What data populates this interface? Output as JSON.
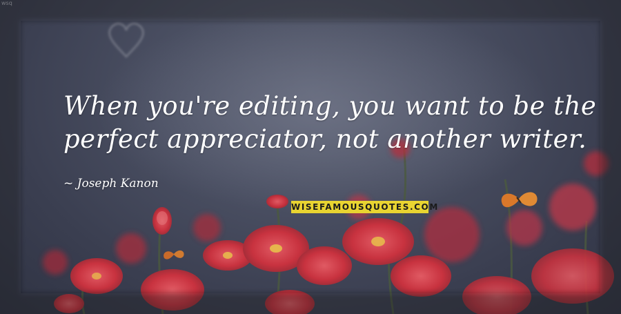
{
  "quote": {
    "line1": "When you're editing, you want to be the",
    "line2": "perfect appreciator, not another writer."
  },
  "author": "~ Joseph Kanon",
  "watermark": "WISEFAMOUSQUOTES.COM",
  "corner_mark": "wsq",
  "colors": {
    "background": "#434859",
    "flower": "#c8323f",
    "watermark_bg": "#e9d431",
    "text": "#ffffff"
  }
}
